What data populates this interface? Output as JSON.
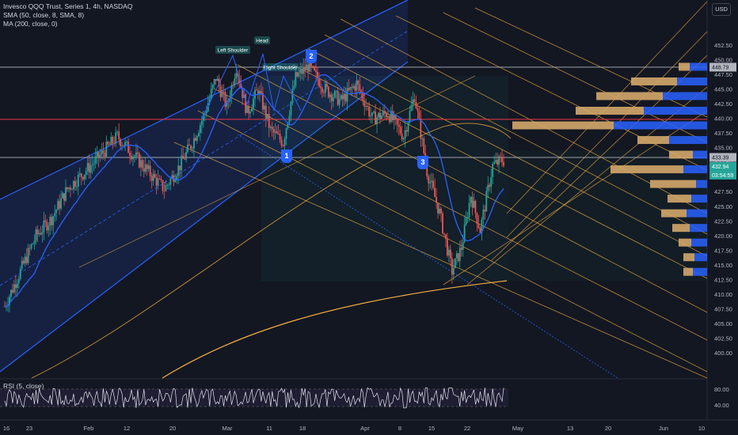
{
  "legend": {
    "title": "Invesco QQQ Trust, Series 1, 4h, NASDAQ",
    "sma": "SMA (50, close, 8, SMA, 8)",
    "ma": "MA (200, close, 0)",
    "rsi": "RSI (5, close)"
  },
  "currency": "USD",
  "price_tags": {
    "upper": "448.79",
    "mid": "433.39",
    "last": "432.94",
    "countdown": "03:54:59"
  },
  "annotations": {
    "left_shoulder": "Left Shoulder",
    "head": "Head",
    "right_shoulder": "Right Shoulder",
    "badge_1": "1",
    "badge_2": "2",
    "badge_3": "3"
  },
  "colors": {
    "background": "#131722",
    "up": "#26a69a",
    "down": "#ef5350",
    "channel": "#2962ff",
    "fib": "#f5b041",
    "hline_red": "#f23645",
    "volume_profile_up": "#2962ff",
    "volume_profile_down": "#d4a76a"
  },
  "chart_data": {
    "type": "candlestick",
    "title": "Invesco QQQ Trust, Series 1, 4h, NASDAQ",
    "y_ticks": [
      "452.50",
      "450.00",
      "447.50",
      "445.00",
      "442.50",
      "440.00",
      "437.50",
      "435.00",
      "432.50",
      "430.00",
      "427.50",
      "425.00",
      "422.50",
      "420.00",
      "417.50",
      "415.00",
      "412.50",
      "410.00",
      "407.50",
      "405.00",
      "402.50",
      "400.00"
    ],
    "ylim": [
      397.5,
      455
    ],
    "x_ticks": [
      "16",
      "23",
      "Feb",
      "12",
      "20",
      "Mar",
      "11",
      "18",
      "Apr",
      "8",
      "15",
      "22",
      "May",
      "13",
      "20",
      "Jun",
      "10"
    ],
    "rsi_ticks": [
      "80.00",
      "40.00"
    ],
    "horizontal_lines": [
      448.8,
      439.9,
      433.4
    ],
    "keypoints": [
      {
        "t": 0,
        "p": 408
      },
      {
        "t": 10,
        "p": 414
      },
      {
        "t": 20,
        "p": 420
      },
      {
        "t": 30,
        "p": 423
      },
      {
        "t": 40,
        "p": 428
      },
      {
        "t": 55,
        "p": 432
      },
      {
        "t": 62,
        "p": 434
      },
      {
        "t": 72,
        "p": 437
      },
      {
        "t": 85,
        "p": 433
      },
      {
        "t": 95,
        "p": 430
      },
      {
        "t": 102,
        "p": 428
      },
      {
        "t": 112,
        "p": 432
      },
      {
        "t": 120,
        "p": 436
      },
      {
        "t": 128,
        "p": 441
      },
      {
        "t": 135,
        "p": 447
      },
      {
        "t": 142,
        "p": 442
      },
      {
        "t": 148,
        "p": 449
      },
      {
        "t": 155,
        "p": 441
      },
      {
        "t": 162,
        "p": 445
      },
      {
        "t": 170,
        "p": 438
      },
      {
        "t": 178,
        "p": 436
      },
      {
        "t": 186,
        "p": 447
      },
      {
        "t": 194,
        "p": 449
      },
      {
        "t": 205,
        "p": 445
      },
      {
        "t": 215,
        "p": 443
      },
      {
        "t": 225,
        "p": 446
      },
      {
        "t": 235,
        "p": 440
      },
      {
        "t": 245,
        "p": 441
      },
      {
        "t": 255,
        "p": 437
      },
      {
        "t": 262,
        "p": 444
      },
      {
        "t": 270,
        "p": 431
      },
      {
        "t": 278,
        "p": 424
      },
      {
        "t": 286,
        "p": 414
      },
      {
        "t": 292,
        "p": 418
      },
      {
        "t": 298,
        "p": 427
      },
      {
        "t": 304,
        "p": 421
      },
      {
        "t": 312,
        "p": 432
      },
      {
        "t": 318,
        "p": 432.9
      }
    ],
    "volume_profile": [
      {
        "price": 448.8,
        "up": 22,
        "down": 14
      },
      {
        "price": 446.3,
        "up": 38,
        "down": 58
      },
      {
        "price": 443.8,
        "up": 56,
        "down": 84
      },
      {
        "price": 441.3,
        "up": 80,
        "down": 86
      },
      {
        "price": 438.8,
        "up": 118,
        "down": 128
      },
      {
        "price": 436.3,
        "up": 48,
        "down": 40
      },
      {
        "price": 433.8,
        "up": 18,
        "down": 30
      },
      {
        "price": 431.3,
        "up": 30,
        "down": 92
      },
      {
        "price": 428.8,
        "up": 14,
        "down": 58
      },
      {
        "price": 426.3,
        "up": 20,
        "down": 30
      },
      {
        "price": 423.8,
        "up": 26,
        "down": 32
      },
      {
        "price": 421.3,
        "up": 22,
        "down": 22
      },
      {
        "price": 418.8,
        "up": 20,
        "down": 16
      },
      {
        "price": 416.3,
        "up": 16,
        "down": 14
      },
      {
        "price": 413.8,
        "up": 18,
        "down": 12
      }
    ]
  }
}
